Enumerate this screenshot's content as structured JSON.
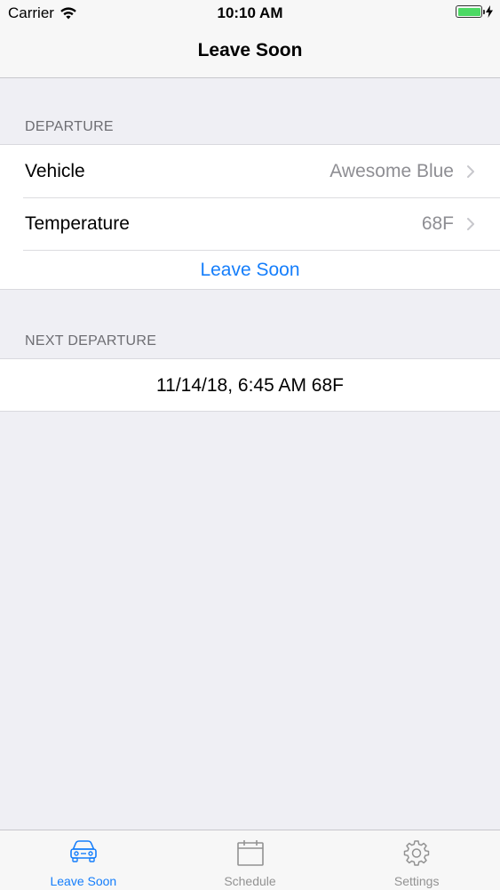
{
  "status_bar": {
    "carrier": "Carrier",
    "time": "10:10 AM",
    "battery_color": "#4cd964"
  },
  "nav": {
    "title": "Leave Soon"
  },
  "departure": {
    "header": "DEPARTURE",
    "vehicle_label": "Vehicle",
    "vehicle_value": "Awesome Blue",
    "temperature_label": "Temperature",
    "temperature_value": "68F",
    "action_label": "Leave Soon"
  },
  "next_departure": {
    "header": "NEXT DEPARTURE",
    "value": "11/14/18, 6:45 AM 68F"
  },
  "tabs": [
    {
      "label": "Leave Soon",
      "icon": "car-icon",
      "active": true
    },
    {
      "label": "Schedule",
      "icon": "calendar-icon",
      "active": false
    },
    {
      "label": "Settings",
      "icon": "gear-icon",
      "active": false
    }
  ],
  "colors": {
    "accent": "#157efb",
    "inactive": "#929292",
    "background": "#efeff4"
  }
}
